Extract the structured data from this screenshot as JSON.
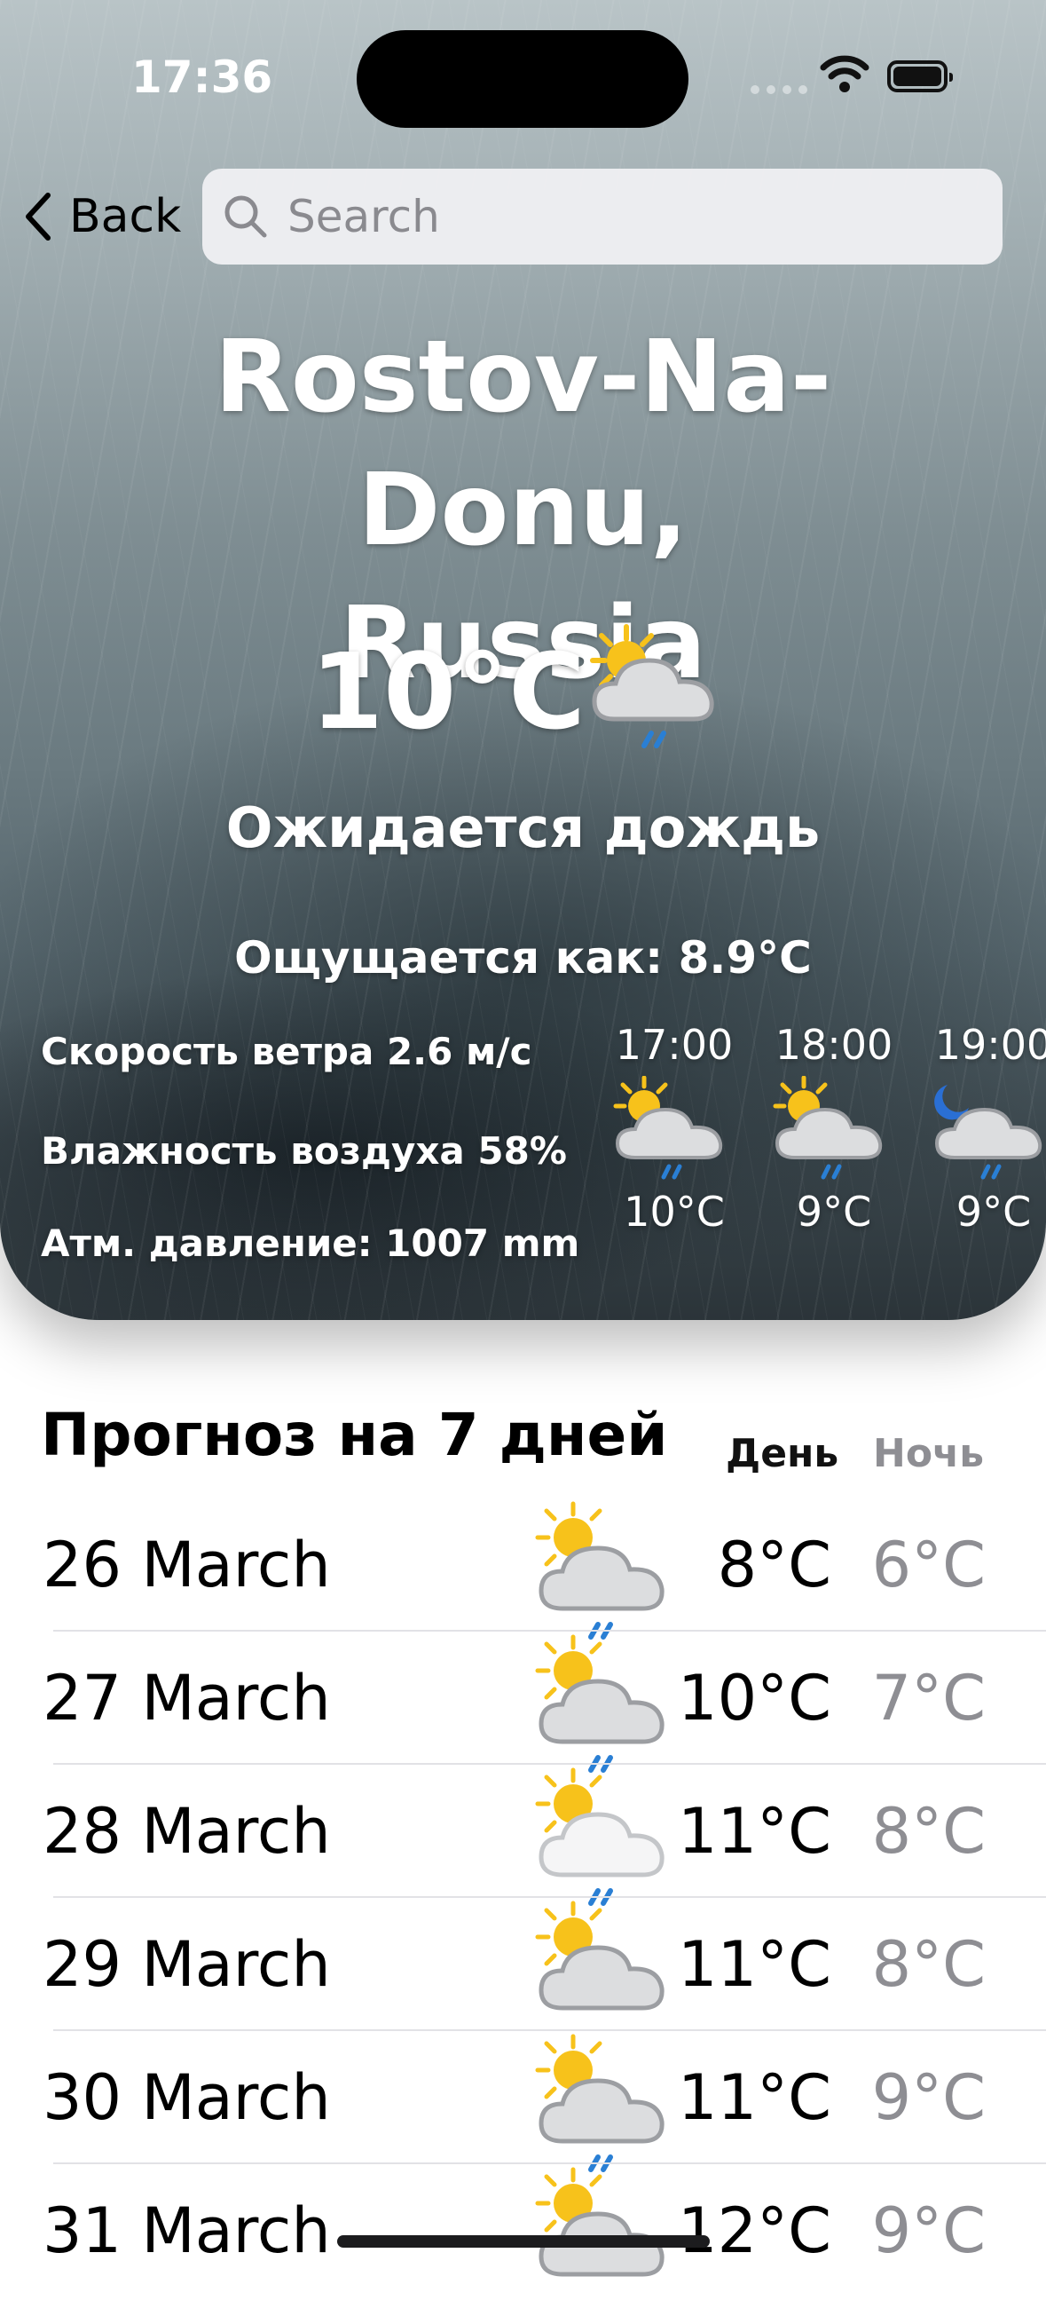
{
  "status_bar": {
    "time": "17:36"
  },
  "nav": {
    "back_label": "Back",
    "search_placeholder": "Search"
  },
  "current": {
    "city": "Rostov-Na-Donu, Russia",
    "temperature": "10°C",
    "icon": "sun-cloud-rain-icon",
    "description": "Ожидается дождь",
    "feels_like": "Ощущается как: 8.9°C",
    "wind": "Скорость ветра 2.6 м/с",
    "humidity": "Влажность воздуха 58%",
    "pressure": "Атм. давление: 1007 mm"
  },
  "hourly": [
    {
      "time": "17:00",
      "icon": "sun-cloud-rain-icon",
      "temp": "10°C"
    },
    {
      "time": "18:00",
      "icon": "sun-cloud-rain-icon",
      "temp": "9°C"
    },
    {
      "time": "19:00",
      "icon": "moon-cloud-rain-icon",
      "temp": "9°C"
    }
  ],
  "forecast": {
    "title": "Прогноз на 7 дней",
    "day_header": "День",
    "night_header": "Ночь",
    "days": [
      {
        "date": "26 March",
        "icon": "sun-cloud-rain-icon",
        "day": "8°C",
        "night": "6°C"
      },
      {
        "date": "27 March",
        "icon": "sun-cloud-rain-icon",
        "day": "10°C",
        "night": "7°C"
      },
      {
        "date": "28 March",
        "icon": "sun-light-cloud-rain-icon",
        "day": "11°C",
        "night": "8°C"
      },
      {
        "date": "29 March",
        "icon": "sun-cloud-icon",
        "day": "11°C",
        "night": "8°C"
      },
      {
        "date": "30 March",
        "icon": "sun-cloud-rain-icon",
        "day": "11°C",
        "night": "9°C"
      },
      {
        "date": "31 March",
        "icon": "sun-cloud-rain-icon",
        "day": "12°C",
        "night": "9°C"
      }
    ]
  },
  "colors": {
    "accent_rain": "#2a7fd4",
    "sun": "#f7c21b",
    "cloud": "#c9cacc"
  }
}
